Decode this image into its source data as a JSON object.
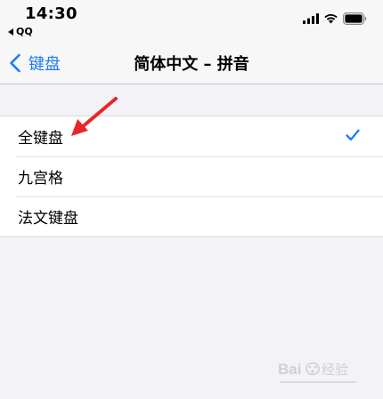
{
  "status_bar": {
    "time": "14:30",
    "back_app": "QQ",
    "signal_icon": "cellular-signal-icon",
    "wifi_icon": "wifi-icon",
    "battery_icon": "battery-icon"
  },
  "nav": {
    "back_label": "键盘",
    "title": "简体中文 – 拼音"
  },
  "options": [
    {
      "label": "全键盘",
      "selected": true
    },
    {
      "label": "九宫格",
      "selected": false
    },
    {
      "label": "法文键盘",
      "selected": false
    }
  ],
  "colors": {
    "accent": "#1a7cf5",
    "background": "#f2f2f7",
    "annotation": "#e8262a"
  },
  "watermark": {
    "brand": "Baidu 经验"
  }
}
